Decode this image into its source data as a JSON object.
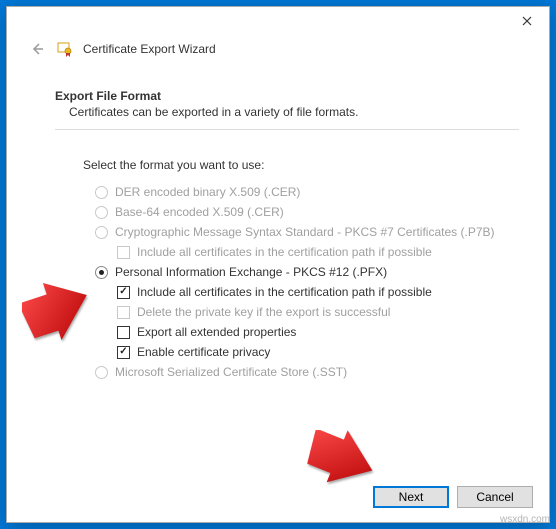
{
  "window": {
    "title": "Certificate Export Wizard"
  },
  "section": {
    "heading": "Export File Format",
    "description": "Certificates can be exported in a variety of file formats."
  },
  "intro": "Select the format you want to use:",
  "options": {
    "der": "DER encoded binary X.509 (.CER)",
    "base64": "Base-64 encoded X.509 (.CER)",
    "pkcs7": "Cryptographic Message Syntax Standard - PKCS #7 Certificates (.P7B)",
    "pkcs7_include": "Include all certificates in the certification path if possible",
    "pfx": "Personal Information Exchange - PKCS #12 (.PFX)",
    "pfx_include": "Include all certificates in the certification path if possible",
    "pfx_delete": "Delete the private key if the export is successful",
    "pfx_ext": "Export all extended properties",
    "pfx_priv": "Enable certificate privacy",
    "sst": "Microsoft Serialized Certificate Store (.SST)"
  },
  "buttons": {
    "next": "Next",
    "cancel": "Cancel"
  },
  "watermark": "wsxdn.com"
}
